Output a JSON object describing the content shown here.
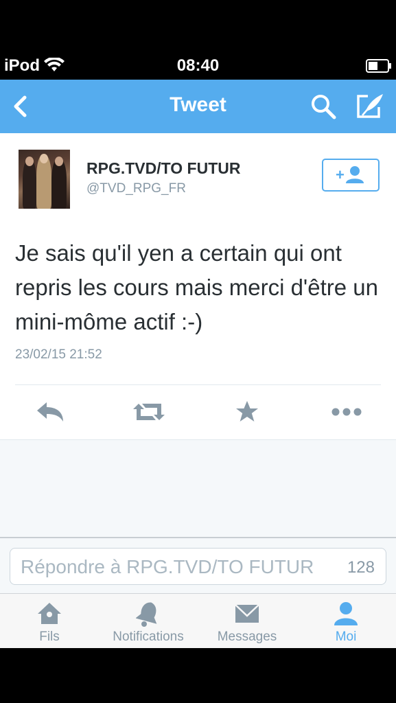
{
  "status_bar": {
    "carrier": "iPod",
    "time": "08:40"
  },
  "nav": {
    "title": "Tweet",
    "back_icon": "chevron-left-icon",
    "search_icon": "search-icon",
    "compose_icon": "compose-icon",
    "color": "#55acee"
  },
  "tweet": {
    "author_name": "RPG.TVD/TO FUTUR",
    "author_handle": "@TVD_RPG_FR",
    "text": "Je sais qu'il yen a certain qui ont repris les cours mais merci d'être un mini-môme actif :-)",
    "timestamp": "23/02/15 21:52",
    "actions": [
      "reply-icon",
      "retweet-icon",
      "favorite-icon",
      "more-icon"
    ]
  },
  "reply": {
    "placeholder": "Répondre à RPG.TVD/TO FUTUR",
    "char_count": "128"
  },
  "tabs": [
    {
      "label": "Fils",
      "icon": "home-icon",
      "active": false
    },
    {
      "label": "Notifications",
      "icon": "bell-icon",
      "active": false
    },
    {
      "label": "Messages",
      "icon": "envelope-icon",
      "active": false
    },
    {
      "label": "Moi",
      "icon": "person-icon",
      "active": true
    }
  ],
  "colors": {
    "accent": "#55acee",
    "text": "#292f33",
    "muted": "#8899a6"
  }
}
